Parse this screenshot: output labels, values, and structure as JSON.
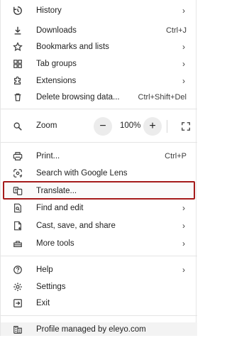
{
  "menu": {
    "history": {
      "label": "History",
      "icon": "history-icon"
    },
    "downloads": {
      "label": "Downloads",
      "shortcut": "Ctrl+J",
      "icon": "download-icon"
    },
    "bookmarks": {
      "label": "Bookmarks and lists",
      "icon": "star-icon"
    },
    "tab_groups": {
      "label": "Tab groups",
      "icon": "tab-groups-icon"
    },
    "extensions": {
      "label": "Extensions",
      "icon": "puzzle-icon"
    },
    "delete_data": {
      "label": "Delete browsing data...",
      "shortcut": "Ctrl+Shift+Del",
      "icon": "trash-icon"
    },
    "zoom": {
      "label": "Zoom",
      "minus": "−",
      "value": "100%",
      "plus": "+",
      "icon": "zoom-icon"
    },
    "print": {
      "label": "Print...",
      "shortcut": "Ctrl+P",
      "icon": "printer-icon"
    },
    "lens": {
      "label": "Search with Google Lens",
      "icon": "lens-icon"
    },
    "translate": {
      "label": "Translate...",
      "icon": "translate-icon"
    },
    "find_edit": {
      "label": "Find and edit",
      "icon": "find-icon"
    },
    "cast_save": {
      "label": "Cast, save, and share",
      "icon": "cast-save-icon"
    },
    "more_tools": {
      "label": "More tools",
      "icon": "toolbox-icon"
    },
    "help": {
      "label": "Help",
      "icon": "help-icon"
    },
    "settings": {
      "label": "Settings",
      "icon": "gear-icon"
    },
    "exit": {
      "label": "Exit",
      "icon": "exit-icon"
    },
    "profile": {
      "label": "Profile managed by eleyo.com",
      "icon": "building-icon"
    }
  },
  "chevron": "›",
  "colors": {
    "highlight": "#a51b1b",
    "text": "#1f1f1f"
  }
}
